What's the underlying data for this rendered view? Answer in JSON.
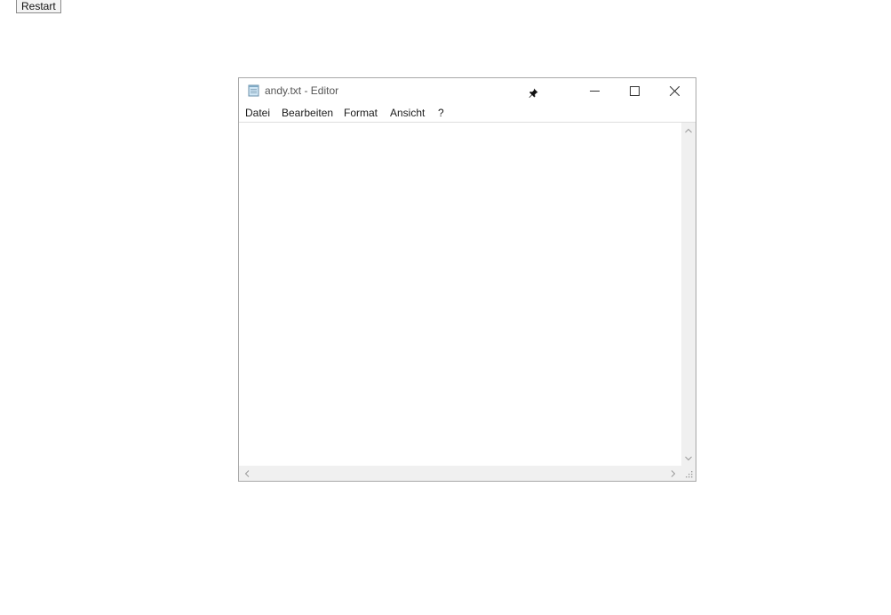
{
  "page": {
    "restart_label": "Restart"
  },
  "window": {
    "title": "andy.txt - Editor",
    "icon": "notepad-icon",
    "pin_icon": "pin-icon",
    "controls": {
      "minimize": "minimize-icon",
      "maximize": "maximize-icon",
      "close": "close-icon"
    }
  },
  "menu": {
    "items": [
      {
        "label": "Datei"
      },
      {
        "label": "Bearbeiten"
      },
      {
        "label": "Format"
      },
      {
        "label": "Ansicht"
      },
      {
        "label": "?"
      }
    ]
  },
  "editor": {
    "content": ""
  },
  "colors": {
    "window_border": "#a8a8a8",
    "scrollbar_bg": "#f0f0f0",
    "title_text": "#555555"
  }
}
